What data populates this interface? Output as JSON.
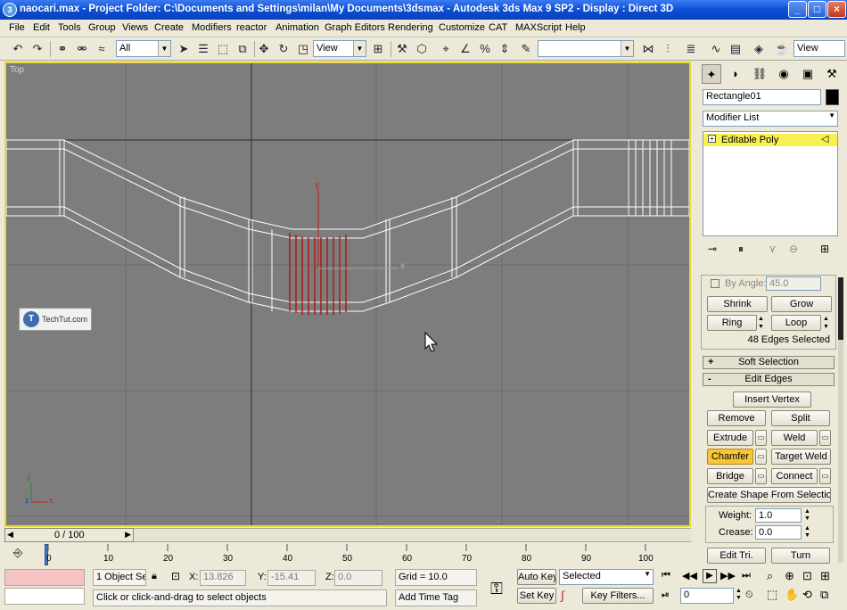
{
  "titlebar": {
    "text": "naocari.max     - Project Folder: C:\\Documents and Settings\\milan\\My Documents\\3dsmax     - Autodesk 3ds Max 9 SP2     - Display : Direct 3D",
    "buttons": [
      "_",
      "□",
      "×"
    ]
  },
  "menubar": {
    "items": [
      "File",
      "Edit",
      "Tools",
      "Group",
      "Views",
      "Create",
      "Modifiers",
      "reactor",
      "Animation",
      "Graph Editors",
      "Rendering",
      "Customize",
      "CAT",
      "MAXScript",
      "Help"
    ]
  },
  "toolbar": {
    "selection_filter": "All",
    "reference_coord": "View",
    "named_selection": "",
    "viewport_layout": "View"
  },
  "viewport": {
    "label": "Top",
    "watermark": "TechTut.com",
    "axis_y": "y",
    "axis_x": "x",
    "gizmo_y": "y",
    "gizmo_x": "x",
    "gizmo_z": "z"
  },
  "command_panel": {
    "object_name": "Rectangle01",
    "object_color": "#000000",
    "modifier_list": "Modifier List",
    "stack_item": "Editable Poly",
    "by_angle_label": "By Angle:",
    "by_angle_value": "45.0",
    "shrink": "Shrink",
    "grow": "Grow",
    "ring": "Ring",
    "loop": "Loop",
    "edges_selected": "48 Edges Selected",
    "soft_selection": "Soft Selection",
    "edit_edges": "Edit Edges",
    "insert_vertex": "Insert Vertex",
    "remove": "Remove",
    "split": "Split",
    "extrude": "Extrude",
    "weld": "Weld",
    "chamfer": "Chamfer",
    "target_weld": "Target Weld",
    "bridge": "Bridge",
    "connect": "Connect",
    "create_shape": "Create Shape From Selection",
    "weight_label": "Weight:",
    "weight_value": "1.0",
    "crease_label": "Crease:",
    "crease_value": "0.0",
    "edit_tri": "Edit Tri.",
    "turn": "Turn"
  },
  "timeline": {
    "frame_display": "0 / 100",
    "ticks": [
      "0",
      "10",
      "20",
      "30",
      "40",
      "50",
      "60",
      "70",
      "80",
      "90",
      "100"
    ]
  },
  "status": {
    "selection_info": "1 Object Se",
    "prompt": "Click or click-and-drag to select objects",
    "x_label": "X:",
    "x_value": "13.826",
    "y_label": "Y:",
    "y_value": "-15.41",
    "z_label": "Z:",
    "z_value": "0.0",
    "grid": "Grid = 10.0",
    "add_time_tag": "Add Time Tag",
    "auto_key": "Auto Key",
    "set_key": "Set Key",
    "key_mode": "Selected",
    "key_filters": "Key Filters...",
    "current_frame": "0"
  },
  "colors": {
    "viewport_bg": "#7d7d7d",
    "active_border": "#e8d838",
    "selected_edges": "#b01818",
    "wire": "#ffffff",
    "chamfer_active": "#f7c638"
  }
}
